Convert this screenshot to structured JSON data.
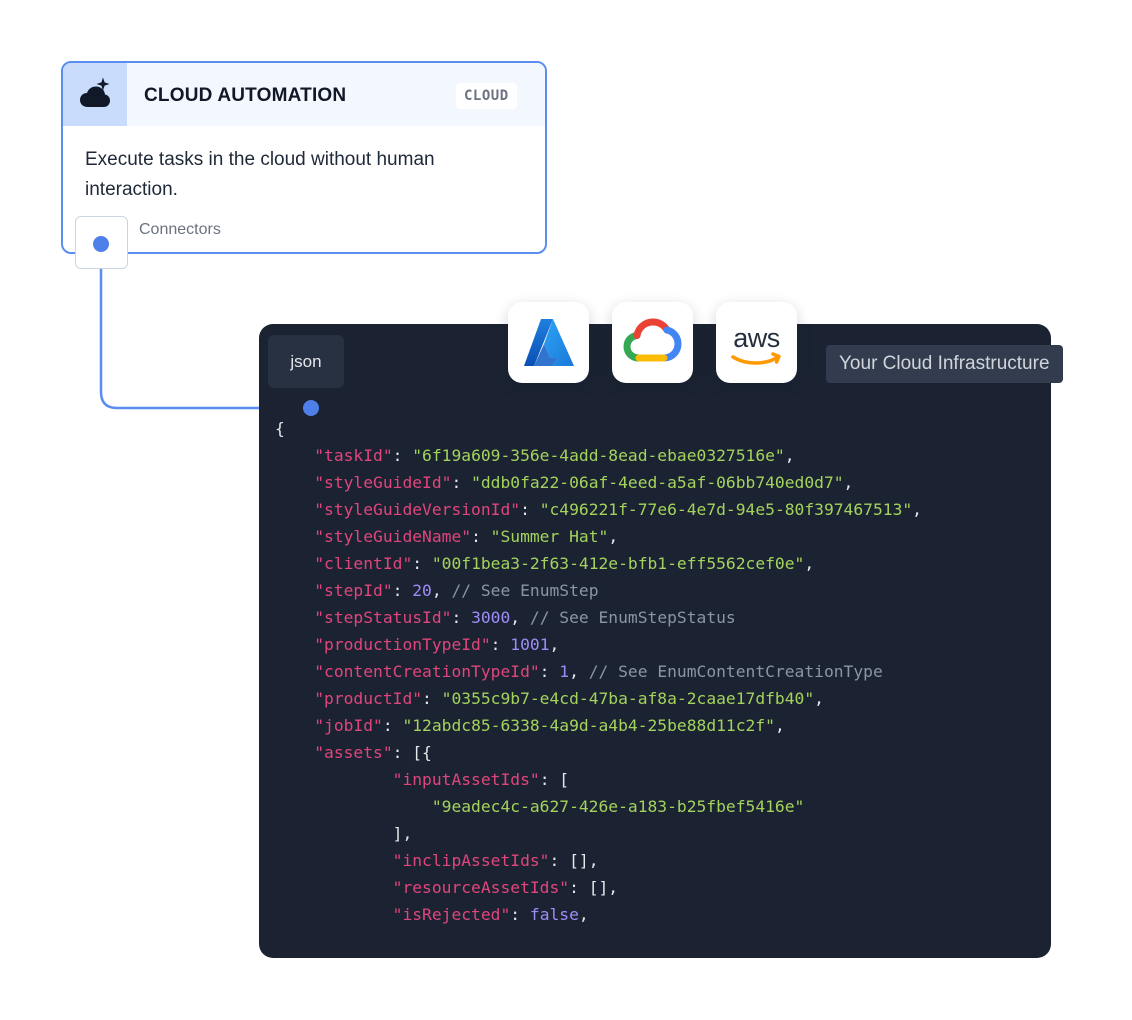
{
  "card": {
    "title": "CLOUD AUTOMATION",
    "badge": "CLOUD",
    "description": "Execute tasks in the cloud without human interaction.",
    "connectors_label": "Connectors",
    "icon": "cloud-sparkle-icon",
    "accent_color": "#5b8def"
  },
  "cloud_logos": [
    {
      "name": "azure-logo"
    },
    {
      "name": "google-cloud-logo"
    },
    {
      "name": "aws-logo",
      "text": "aws"
    }
  ],
  "infra_label": "Your Cloud Infrastructure",
  "code_panel": {
    "language": "json",
    "lines": [
      {
        "indent": "",
        "parts": [
          {
            "t": "p",
            "v": "{"
          }
        ]
      },
      {
        "indent": "    ",
        "parts": [
          {
            "t": "k",
            "v": "\"taskId\""
          },
          {
            "t": "p",
            "v": ": "
          },
          {
            "t": "s",
            "v": "\"6f19a609-356e-4add-8ead-ebae0327516e\""
          },
          {
            "t": "p",
            "v": ","
          }
        ]
      },
      {
        "indent": "    ",
        "parts": [
          {
            "t": "k",
            "v": "\"styleGuideId\""
          },
          {
            "t": "p",
            "v": ": "
          },
          {
            "t": "s",
            "v": "\"ddb0fa22-06af-4eed-a5af-06bb740ed0d7\""
          },
          {
            "t": "p",
            "v": ","
          }
        ]
      },
      {
        "indent": "    ",
        "parts": [
          {
            "t": "k",
            "v": "\"styleGuideVersionId\""
          },
          {
            "t": "p",
            "v": ": "
          },
          {
            "t": "s",
            "v": "\"c496221f-77e6-4e7d-94e5-80f397467513\""
          },
          {
            "t": "p",
            "v": ","
          }
        ]
      },
      {
        "indent": "    ",
        "parts": [
          {
            "t": "k",
            "v": "\"styleGuideName\""
          },
          {
            "t": "p",
            "v": ": "
          },
          {
            "t": "s",
            "v": "\"Summer Hat\""
          },
          {
            "t": "p",
            "v": ","
          }
        ]
      },
      {
        "indent": "    ",
        "parts": [
          {
            "t": "k",
            "v": "\"clientId\""
          },
          {
            "t": "p",
            "v": ": "
          },
          {
            "t": "s",
            "v": "\"00f1bea3-2f63-412e-bfb1-eff5562cef0e\""
          },
          {
            "t": "p",
            "v": ","
          }
        ]
      },
      {
        "indent": "    ",
        "parts": [
          {
            "t": "k",
            "v": "\"stepId\""
          },
          {
            "t": "p",
            "v": ": "
          },
          {
            "t": "n",
            "v": "20"
          },
          {
            "t": "p",
            "v": ", "
          },
          {
            "t": "c",
            "v": "// See EnumStep"
          }
        ]
      },
      {
        "indent": "    ",
        "parts": [
          {
            "t": "k",
            "v": "\"stepStatusId\""
          },
          {
            "t": "p",
            "v": ": "
          },
          {
            "t": "n",
            "v": "3000"
          },
          {
            "t": "p",
            "v": ", "
          },
          {
            "t": "c",
            "v": "// See EnumStepStatus"
          }
        ]
      },
      {
        "indent": "    ",
        "parts": [
          {
            "t": "k",
            "v": "\"productionTypeId\""
          },
          {
            "t": "p",
            "v": ": "
          },
          {
            "t": "n",
            "v": "1001"
          },
          {
            "t": "p",
            "v": ","
          }
        ]
      },
      {
        "indent": "    ",
        "parts": [
          {
            "t": "k",
            "v": "\"contentCreationTypeId\""
          },
          {
            "t": "p",
            "v": ": "
          },
          {
            "t": "n",
            "v": "1"
          },
          {
            "t": "p",
            "v": ", "
          },
          {
            "t": "c",
            "v": "// See EnumContentCreationType"
          }
        ]
      },
      {
        "indent": "    ",
        "parts": [
          {
            "t": "k",
            "v": "\"productId\""
          },
          {
            "t": "p",
            "v": ": "
          },
          {
            "t": "s",
            "v": "\"0355c9b7-e4cd-47ba-af8a-2caae17dfb40\""
          },
          {
            "t": "p",
            "v": ","
          }
        ]
      },
      {
        "indent": "    ",
        "parts": [
          {
            "t": "k",
            "v": "\"jobId\""
          },
          {
            "t": "p",
            "v": ": "
          },
          {
            "t": "s",
            "v": "\"12abdc85-6338-4a9d-a4b4-25be88d11c2f\""
          },
          {
            "t": "p",
            "v": ","
          }
        ]
      },
      {
        "indent": "    ",
        "parts": [
          {
            "t": "k",
            "v": "\"assets\""
          },
          {
            "t": "p",
            "v": ": [{"
          }
        ]
      },
      {
        "indent": "            ",
        "parts": [
          {
            "t": "k",
            "v": "\"inputAssetIds\""
          },
          {
            "t": "p",
            "v": ": ["
          }
        ]
      },
      {
        "indent": "                ",
        "parts": [
          {
            "t": "s",
            "v": "\"9eadec4c-a627-426e-a183-b25fbef5416e\""
          }
        ]
      },
      {
        "indent": "            ",
        "parts": [
          {
            "t": "p",
            "v": "],"
          }
        ]
      },
      {
        "indent": "            ",
        "parts": [
          {
            "t": "k",
            "v": "\"inclipAssetIds\""
          },
          {
            "t": "p",
            "v": ": [],"
          }
        ]
      },
      {
        "indent": "            ",
        "parts": [
          {
            "t": "k",
            "v": "\"resourceAssetIds\""
          },
          {
            "t": "p",
            "v": ": [],"
          }
        ]
      },
      {
        "indent": "            ",
        "parts": [
          {
            "t": "k",
            "v": "\"isRejected\""
          },
          {
            "t": "p",
            "v": ": "
          },
          {
            "t": "b",
            "v": "false"
          },
          {
            "t": "p",
            "v": ","
          }
        ]
      }
    ]
  },
  "colors": {
    "panel_bg": "#1b2332",
    "key": "#e0457b",
    "string": "#a3d35c",
    "number": "#9d8cf5",
    "comment": "#8b95a7"
  }
}
